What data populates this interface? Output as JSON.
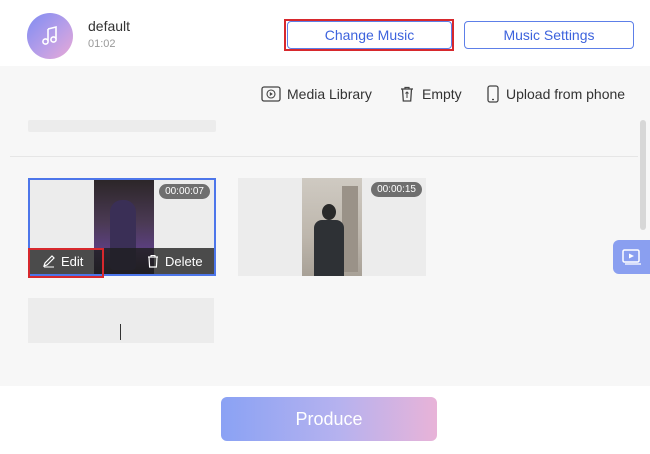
{
  "music": {
    "title": "default",
    "duration": "01:02",
    "icon": "music-note-icon"
  },
  "header": {
    "change_music_label": "Change Music",
    "music_settings_label": "Music Settings"
  },
  "toolbar": {
    "media_library_label": "Media Library",
    "empty_label": "Empty",
    "upload_label": "Upload from phone"
  },
  "clips": [
    {
      "duration": "00:00:07",
      "edit_label": "Edit",
      "delete_label": "Delete",
      "selected": true
    },
    {
      "duration": "00:00:15",
      "selected": false
    }
  ],
  "footer": {
    "produce_label": "Produce"
  },
  "colors": {
    "accent": "#3d63dd",
    "highlight_box": "#d7282d",
    "produce_gradient_start": "#8aa2f4",
    "produce_gradient_end": "#e8b3d8"
  }
}
